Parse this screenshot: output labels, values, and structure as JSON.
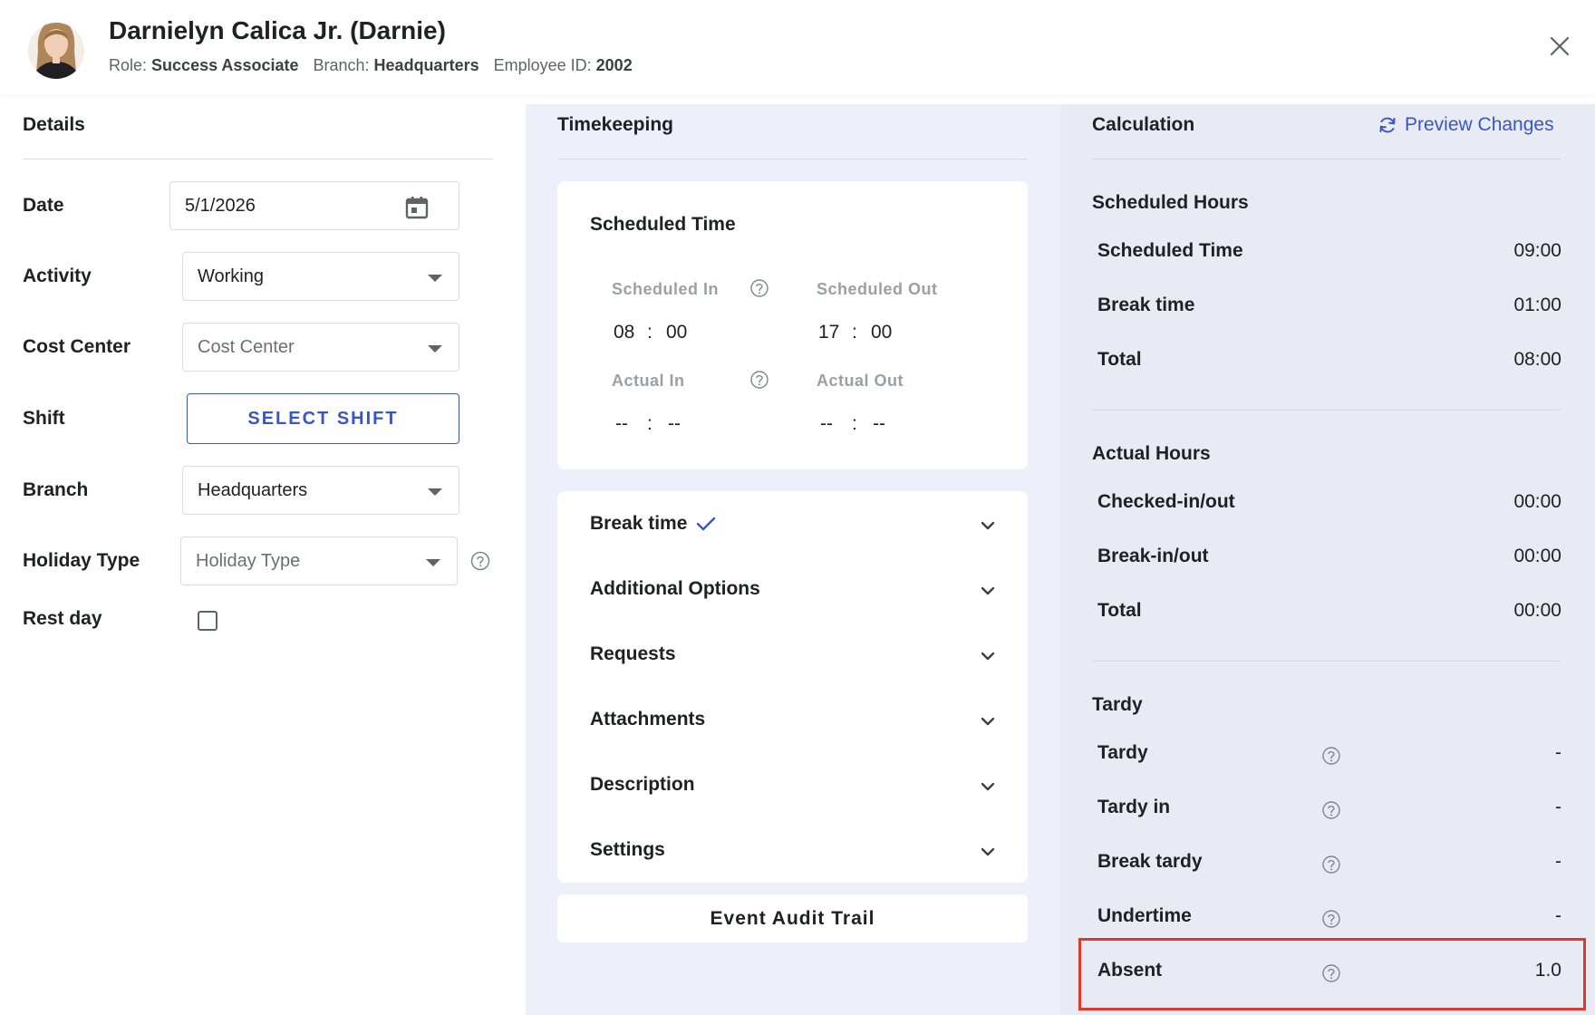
{
  "header": {
    "name": "Darnielyn Calica Jr. (Darnie)",
    "role_label": "Role:",
    "role": "Success Associate",
    "branch_label": "Branch:",
    "branch": "Headquarters",
    "emp_id_label": "Employee ID:",
    "emp_id": "2002"
  },
  "details": {
    "title": "Details",
    "date_label": "Date",
    "date_value": "5/1/2026",
    "activity_label": "Activity",
    "activity_value": "Working",
    "cost_center_label": "Cost Center",
    "cost_center_placeholder": "Cost Center",
    "shift_label": "Shift",
    "select_shift": "SELECT SHIFT",
    "branch_label": "Branch",
    "branch_value": "Headquarters",
    "holiday_label": "Holiday Type",
    "holiday_placeholder": "Holiday Type",
    "rest_day_label": "Rest day"
  },
  "timekeeping": {
    "title": "Timekeeping",
    "scheduled_time_title": "Scheduled Time",
    "scheduled_in_label": "Scheduled In",
    "scheduled_out_label": "Scheduled Out",
    "sched_in_h": "08",
    "sched_in_m": "00",
    "sched_out_h": "17",
    "sched_out_m": "00",
    "actual_in_label": "Actual In",
    "actual_out_label": "Actual Out",
    "actual_in_h": "--",
    "actual_in_m": "--",
    "actual_out_h": "--",
    "actual_out_m": "--",
    "colon": ":",
    "accordions": [
      "Break time",
      "Additional Options",
      "Requests",
      "Attachments",
      "Description",
      "Settings"
    ],
    "audit_trail": "Event Audit Trail"
  },
  "calculation": {
    "title": "Calculation",
    "preview_changes": "Preview Changes",
    "scheduled_hours": {
      "title": "Scheduled Hours",
      "rows": [
        {
          "label": "Scheduled Time",
          "value": "09:00"
        },
        {
          "label": "Break time",
          "value": "01:00"
        },
        {
          "label": "Total",
          "value": "08:00"
        }
      ]
    },
    "actual_hours": {
      "title": "Actual Hours",
      "rows": [
        {
          "label": "Checked-in/out",
          "value": "00:00"
        },
        {
          "label": "Break-in/out",
          "value": "00:00"
        },
        {
          "label": "Total",
          "value": "00:00"
        }
      ]
    },
    "tardy": {
      "title": "Tardy",
      "rows": [
        {
          "label": "Tardy",
          "value": "-"
        },
        {
          "label": "Tardy in",
          "value": "-"
        },
        {
          "label": "Break tardy",
          "value": "-"
        },
        {
          "label": "Undertime",
          "value": "-"
        },
        {
          "label": "Absent",
          "value": "1.0"
        }
      ]
    }
  },
  "colors": {
    "accent": "#3a56c5",
    "highlight_border": "#e0392b",
    "mid_panel": "#edf0fa",
    "right_panel": "#e8ebf4"
  }
}
